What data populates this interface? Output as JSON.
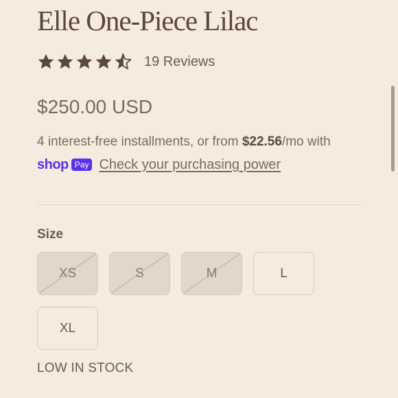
{
  "product": {
    "title": "Elle One-Piece Lilac",
    "rating": 4.5,
    "reviews_label": "19 Reviews",
    "price": "$250.00 USD"
  },
  "installments": {
    "prefix": "4 interest-free installments, or from ",
    "amount": "$22.56",
    "suffix": "/mo with"
  },
  "shoppay": {
    "shop_word": "shop",
    "pay_badge": "Pay",
    "link_label": "Check your purchasing power"
  },
  "size": {
    "label": "Size",
    "options": [
      {
        "label": "XS",
        "available": false
      },
      {
        "label": "S",
        "available": false
      },
      {
        "label": "M",
        "available": false
      },
      {
        "label": "L",
        "available": true
      },
      {
        "label": "XL",
        "available": true
      }
    ]
  },
  "stock_status": "LOW IN STOCK",
  "colors": {
    "star": "#5c4739",
    "shoppay": "#5a31f4",
    "background": "#f5ebdf"
  }
}
